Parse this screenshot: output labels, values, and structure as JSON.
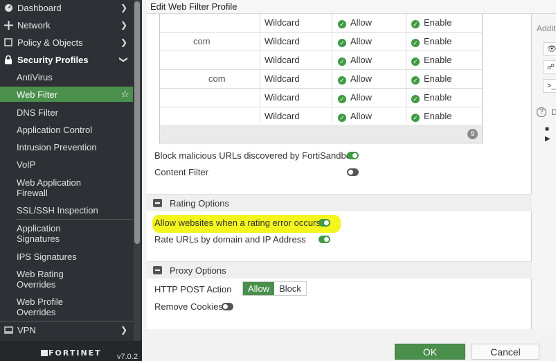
{
  "sidebar": {
    "items": [
      {
        "label": "Dashboard",
        "icon": "dashboard-icon"
      },
      {
        "label": "Network",
        "icon": "network-icon"
      },
      {
        "label": "Policy & Objects",
        "icon": "policy-icon"
      },
      {
        "label": "Security Profiles",
        "icon": "lock-icon"
      }
    ],
    "security_children": [
      "AntiVirus",
      "Web Filter",
      "DNS Filter",
      "Application Control",
      "Intrusion Prevention",
      "VoIP",
      "Web Application Firewall",
      "SSL/SSH Inspection",
      "Application Signatures",
      "IPS Signatures",
      "Web Rating Overrides",
      "Web Profile Overrides"
    ],
    "vpn": {
      "label": "VPN",
      "icon": "vpn-icon"
    },
    "brand": "FORTINET",
    "version": "v7.0.2"
  },
  "dialog": {
    "title": "Edit Web Filter Profile",
    "url_table": {
      "rows": [
        {
          "url": "",
          "type": "Wildcard",
          "action": "Allow",
          "status": "Enable"
        },
        {
          "url": "com",
          "type": "Wildcard",
          "action": "Allow",
          "status": "Enable"
        },
        {
          "url": "",
          "type": "Wildcard",
          "action": "Allow",
          "status": "Enable"
        },
        {
          "url": "com",
          "type": "Wildcard",
          "action": "Allow",
          "status": "Enable"
        },
        {
          "url": "",
          "type": "Wildcard",
          "action": "Allow",
          "status": "Enable"
        },
        {
          "url": "",
          "type": "Wildcard",
          "action": "Allow",
          "status": "Enable"
        }
      ],
      "count": "9"
    },
    "options": {
      "block_malicious": {
        "label": "Block malicious URLs discovered by FortiSandbox",
        "enabled": true
      },
      "content_filter": {
        "label": "Content Filter",
        "enabled": false
      }
    },
    "rating_options": {
      "title": "Rating Options",
      "allow_on_error": {
        "label": "Allow websites when a rating error occurs",
        "enabled": true,
        "highlight_color": "#f3f51c"
      },
      "rate_by_domain": {
        "label": "Rate URLs by domain and IP Address",
        "enabled": true
      }
    },
    "proxy_options": {
      "title": "Proxy Options",
      "http_post": {
        "label": "HTTP POST Action",
        "options": [
          "Allow",
          "Block"
        ],
        "selected": "Allow"
      },
      "remove_cookies": {
        "label": "Remove Cookies",
        "enabled": false
      }
    },
    "buttons": {
      "ok": "OK",
      "cancel": "Cancel"
    },
    "side_panel": {
      "heading": "Additi",
      "help_letter": "D"
    }
  },
  "colors": {
    "accent": "#4a8f4c",
    "sidebar_bg": "#2d3135",
    "toggle_on": "#3f9a43"
  }
}
